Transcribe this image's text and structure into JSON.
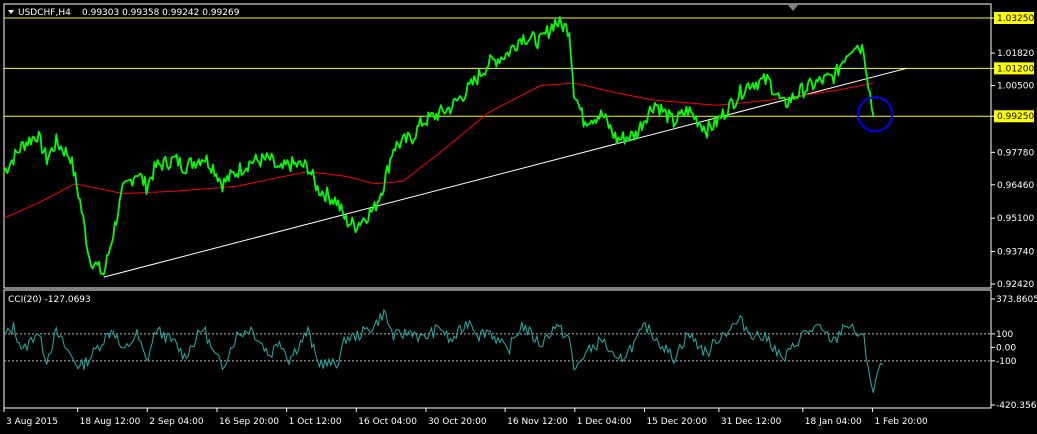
{
  "header": {
    "symbol": "USDCHF,H4",
    "ohlc": "0.99303 0.99358 0.99242 0.99269"
  },
  "colors": {
    "background": "#000000",
    "frame": "#ffffff",
    "price": "#00ff00",
    "ma": "#ff0000",
    "trendline": "#ffffff",
    "hline": "#ffff00",
    "cci": "#20b2aa",
    "circle": "#0000ff"
  },
  "chart_data": [
    {
      "type": "line",
      "y_ticks": [
        "1.03250",
        "1.01820",
        "1.01200",
        "1.00500",
        "0.99250",
        "0.97780",
        "0.96460",
        "0.95100",
        "0.93740",
        "0.92420"
      ],
      "highlighted_levels": [
        {
          "label": "1.03250",
          "value": 1.0325
        },
        {
          "label": "1.01200",
          "value": 1.012
        },
        {
          "label": "0.99250",
          "value": 0.9925
        }
      ],
      "ylim": [
        0.9242,
        1.0325
      ],
      "x_labels": [
        "3 Aug 2015",
        "18 Aug 12:00",
        "2 Sep 04:00",
        "16 Sep 20:00",
        "1 Oct 12:00",
        "16 Oct 04:00",
        "30 Oct 20:00",
        "16 Nov 12:00",
        "1 Dec 04:00",
        "15 Dec 20:00",
        "31 Dec 12:00",
        "18 Jan 04:00",
        "1 Feb 20:00"
      ],
      "series": [
        {
          "role": "price",
          "values": [
            [
              "3 Aug 2015",
              0.97
            ],
            [
              "7 Aug",
              0.981
            ],
            [
              "10 Aug",
              0.985
            ],
            [
              "12 Aug",
              0.975
            ],
            [
              "14 Aug",
              0.982
            ],
            [
              "17 Aug",
              0.976
            ],
            [
              "19 Aug",
              0.958
            ],
            [
              "21 Aug",
              0.935
            ],
            [
              "24 Aug",
              0.928
            ],
            [
              "26 Aug",
              0.945
            ],
            [
              "28 Aug",
              0.962
            ],
            [
              "31 Aug",
              0.97
            ],
            [
              "2 Sep",
              0.964
            ],
            [
              "4 Sep",
              0.972
            ],
            [
              "8 Sep",
              0.975
            ],
            [
              "10 Sep",
              0.972
            ],
            [
              "14 Sep",
              0.976
            ],
            [
              "16 Sep",
              0.972
            ],
            [
              "18 Sep",
              0.965
            ],
            [
              "21 Sep",
              0.97
            ],
            [
              "24 Sep",
              0.974
            ],
            [
              "28 Sep",
              0.975
            ],
            [
              "30 Sep",
              0.97
            ],
            [
              "2 Oct",
              0.973
            ],
            [
              "6 Oct",
              0.972
            ],
            [
              "8 Oct",
              0.963
            ],
            [
              "12 Oct",
              0.958
            ],
            [
              "14 Oct",
              0.95
            ],
            [
              "16 Oct",
              0.948
            ],
            [
              "20 Oct",
              0.955
            ],
            [
              "22 Oct",
              0.965
            ],
            [
              "24 Oct",
              0.98
            ],
            [
              "28 Oct",
              0.984
            ],
            [
              "30 Oct",
              0.99
            ],
            [
              "3 Nov",
              0.994
            ],
            [
              "5 Nov",
              0.996
            ],
            [
              "9 Nov",
              1.004
            ],
            [
              "11 Nov",
              1.009
            ],
            [
              "13 Nov",
              1.014
            ],
            [
              "17 Nov",
              1.018
            ],
            [
              "20 Nov",
              1.025
            ],
            [
              "24 Nov",
              1.023
            ],
            [
              "27 Nov",
              1.031
            ],
            [
              "30 Nov",
              1.028
            ],
            [
              "1 Dec",
              1.003
            ],
            [
              "3 Dec",
              0.991
            ],
            [
              "7 Dec",
              0.993
            ],
            [
              "10 Dec",
              0.983
            ],
            [
              "14 Dec",
              0.985
            ],
            [
              "16 Dec",
              0.992
            ],
            [
              "18 Dec",
              0.998
            ],
            [
              "22 Dec",
              0.99
            ],
            [
              "25 Dec",
              0.995
            ],
            [
              "29 Dec",
              0.987
            ],
            [
              "31 Dec",
              0.99
            ],
            [
              "5 Jan",
              1.002
            ],
            [
              "7 Jan",
              1.006
            ],
            [
              "11 Jan",
              1.007
            ],
            [
              "14 Jan",
              0.997
            ],
            [
              "18 Jan",
              1.003
            ],
            [
              "21 Jan",
              1.006
            ],
            [
              "25 Jan",
              1.009
            ],
            [
              "27 Jan",
              1.017
            ],
            [
              "29 Jan",
              1.022
            ],
            [
              "31 Jan",
              1.02
            ],
            [
              "1 Feb",
              1.006
            ],
            [
              "2 Feb",
              0.9927
            ]
          ]
        },
        {
          "role": "moving-average",
          "values": [
            [
              "3 Aug 2015",
              0.951
            ],
            [
              "10 Aug",
              0.957
            ],
            [
              "18 Aug",
              0.965
            ],
            [
              "28 Aug",
              0.961
            ],
            [
              "8 Sep",
              0.962
            ],
            [
              "21 Sep",
              0.964
            ],
            [
              "6 Oct",
              0.97
            ],
            [
              "14 Oct",
              0.968
            ],
            [
              "20 Oct",
              0.965
            ],
            [
              "26 Oct",
              0.966
            ],
            [
              "3 Nov",
              0.978
            ],
            [
              "13 Nov",
              0.994
            ],
            [
              "24 Nov",
              1.005
            ],
            [
              "1 Dec",
              1.006
            ],
            [
              "10 Dec",
              1.002
            ],
            [
              "18 Dec",
              0.999
            ],
            [
              "31 Dec",
              0.997
            ],
            [
              "11 Jan",
              0.999
            ],
            [
              "25 Jan",
              1.003
            ],
            [
              "2 Feb",
              1.0059
            ]
          ]
        },
        {
          "role": "trendline",
          "values": [
            [
              "24 Aug",
              0.927
            ],
            [
              "9 Feb",
              1.012
            ]
          ]
        }
      ]
    },
    {
      "type": "line",
      "title": "CCI(20) -127.0693",
      "y_ticks": [
        "373.8605",
        "100",
        "0.00",
        "-100",
        "-420.3565"
      ],
      "ylim": [
        -420.3565,
        373.8605
      ],
      "levels": [
        100,
        -100
      ],
      "series": [
        {
          "role": "cci",
          "values": [
            [
              "3 Aug 2015",
              80
            ],
            [
              "5 Aug",
              150
            ],
            [
              "7 Aug",
              -30
            ],
            [
              "10 Aug",
              120
            ],
            [
              "12 Aug",
              -90
            ],
            [
              "14 Aug",
              110
            ],
            [
              "17 Aug",
              -60
            ],
            [
              "19 Aug",
              -150
            ],
            [
              "21 Aug",
              -80
            ],
            [
              "24 Aug",
              60
            ],
            [
              "26 Aug",
              140
            ],
            [
              "28 Aug",
              -40
            ],
            [
              "31 Aug",
              100
            ],
            [
              "2 Sep",
              -110
            ],
            [
              "4 Sep",
              130
            ],
            [
              "8 Sep",
              30
            ],
            [
              "10 Sep",
              -70
            ],
            [
              "14 Sep",
              150
            ],
            [
              "16 Sep",
              -40
            ],
            [
              "18 Sep",
              -140
            ],
            [
              "21 Sep",
              90
            ],
            [
              "24 Sep",
              140
            ],
            [
              "28 Sep",
              -60
            ],
            [
              "30 Sep",
              60
            ],
            [
              "2 Oct",
              -90
            ],
            [
              "6 Oct",
              120
            ],
            [
              "8 Oct",
              -110
            ],
            [
              "12 Oct",
              -130
            ],
            [
              "14 Oct",
              70
            ],
            [
              "16 Oct",
              80
            ],
            [
              "20 Oct",
              160
            ],
            [
              "22 Oct",
              260
            ],
            [
              "24 Oct",
              80
            ],
            [
              "28 Oct",
              120
            ],
            [
              "30 Oct",
              60
            ],
            [
              "3 Nov",
              150
            ],
            [
              "5 Nov",
              40
            ],
            [
              "9 Nov",
              200
            ],
            [
              "11 Nov",
              90
            ],
            [
              "13 Nov",
              130
            ],
            [
              "17 Nov",
              -30
            ],
            [
              "20 Nov",
              170
            ],
            [
              "24 Nov",
              20
            ],
            [
              "27 Nov",
              160
            ],
            [
              "30 Nov",
              70
            ],
            [
              "1 Dec",
              -180
            ],
            [
              "3 Dec",
              -60
            ],
            [
              "7 Dec",
              60
            ],
            [
              "10 Dec",
              -120
            ],
            [
              "14 Dec",
              40
            ],
            [
              "16 Dec",
              160
            ],
            [
              "18 Dec",
              80
            ],
            [
              "22 Dec",
              -80
            ],
            [
              "25 Dec",
              100
            ],
            [
              "29 Dec",
              -50
            ],
            [
              "31 Dec",
              60
            ],
            [
              "5 Jan",
              200
            ],
            [
              "7 Jan",
              110
            ],
            [
              "11 Jan",
              60
            ],
            [
              "14 Jan",
              -100
            ],
            [
              "18 Jan",
              90
            ],
            [
              "21 Jan",
              150
            ],
            [
              "25 Jan",
              40
            ],
            [
              "27 Jan",
              180
            ],
            [
              "29 Jan",
              120
            ],
            [
              "31 Jan",
              60
            ],
            [
              "1 Feb",
              -150
            ],
            [
              "2 Feb",
              -330
            ],
            [
              "3 Feb",
              -180
            ],
            [
              "4 Feb",
              -127.0693
            ]
          ]
        }
      ]
    }
  ]
}
